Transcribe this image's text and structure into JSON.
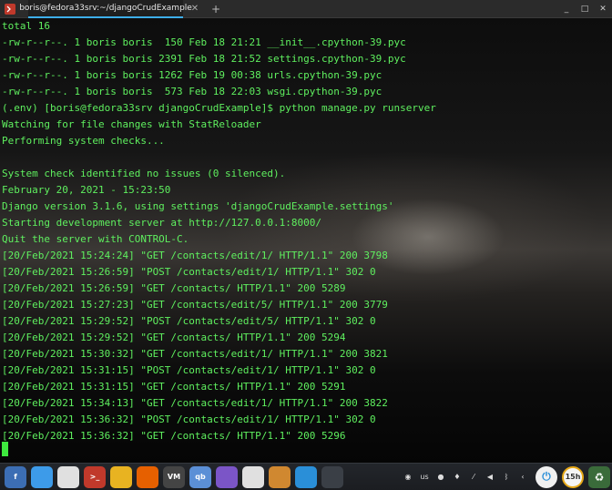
{
  "window": {
    "tab_title": "boris@fedora33srv:~/djangoCrudExample",
    "tab_close_glyph": "✕",
    "new_tab_glyph": "+",
    "minimize_glyph": "_",
    "maximize_glyph": "□",
    "close_glyph": "✕"
  },
  "terminal": {
    "lines": [
      "total 16",
      "-rw-r--r--. 1 boris boris  150 Feb 18 21:21 __init__.cpython-39.pyc",
      "-rw-r--r--. 1 boris boris 2391 Feb 18 21:52 settings.cpython-39.pyc",
      "-rw-r--r--. 1 boris boris 1262 Feb 19 00:38 urls.cpython-39.pyc",
      "-rw-r--r--. 1 boris boris  573 Feb 18 22:03 wsgi.cpython-39.pyc",
      "(.env) [boris@fedora33srv djangoCrudExample]$ python manage.py runserver",
      "Watching for file changes with StatReloader",
      "Performing system checks...",
      "",
      "System check identified no issues (0 silenced).",
      "February 20, 2021 - 15:23:50",
      "Django version 3.1.6, using settings 'djangoCrudExample.settings'",
      "Starting development server at http://127.0.0.1:8000/",
      "Quit the server with CONTROL-C.",
      "[20/Feb/2021 15:24:24] \"GET /contacts/edit/1/ HTTP/1.1\" 200 3798",
      "[20/Feb/2021 15:26:59] \"POST /contacts/edit/1/ HTTP/1.1\" 302 0",
      "[20/Feb/2021 15:26:59] \"GET /contacts/ HTTP/1.1\" 200 5289",
      "[20/Feb/2021 15:27:23] \"GET /contacts/edit/5/ HTTP/1.1\" 200 3779",
      "[20/Feb/2021 15:29:52] \"POST /contacts/edit/5/ HTTP/1.1\" 302 0",
      "[20/Feb/2021 15:29:52] \"GET /contacts/ HTTP/1.1\" 200 5294",
      "[20/Feb/2021 15:30:32] \"GET /contacts/edit/1/ HTTP/1.1\" 200 3821",
      "[20/Feb/2021 15:31:15] \"POST /contacts/edit/1/ HTTP/1.1\" 302 0",
      "[20/Feb/2021 15:31:15] \"GET /contacts/ HTTP/1.1\" 200 5291",
      "[20/Feb/2021 15:34:13] \"GET /contacts/edit/1/ HTTP/1.1\" 200 3822",
      "[20/Feb/2021 15:36:32] \"POST /contacts/edit/1/ HTTP/1.1\" 302 0",
      "[20/Feb/2021 15:36:32] \"GET /contacts/ HTTP/1.1\" 200 5296"
    ]
  },
  "taskbar": {
    "apps": [
      {
        "name": "fedora-icon",
        "label": "f",
        "color": "#3c6eb4"
      },
      {
        "name": "software-store-icon",
        "label": "",
        "color": "#3d9be9"
      },
      {
        "name": "settings-gear-icon",
        "label": "",
        "color": "#e0e0e0"
      },
      {
        "name": "terminal-icon",
        "label": ">_",
        "color": "#c0392b"
      },
      {
        "name": "chrome-icon",
        "label": "",
        "color": "#e8b321"
      },
      {
        "name": "firefox-icon",
        "label": "",
        "color": "#e66000"
      },
      {
        "name": "virt-manager-icon",
        "label": "VM",
        "color": "#444444"
      },
      {
        "name": "qbittorrent-icon",
        "label": "qb",
        "color": "#5b8fd6"
      },
      {
        "name": "media-player-icon",
        "label": "",
        "color": "#7b55c7"
      },
      {
        "name": "theme-tool-icon",
        "label": "",
        "color": "#e0e0e0"
      },
      {
        "name": "image-viewer-icon",
        "label": "",
        "color": "#d08830"
      },
      {
        "name": "window-switcher-icon",
        "label": "",
        "color": "#2a8fd8"
      },
      {
        "name": "monitor-icon",
        "label": "",
        "color": "#3a3f46"
      }
    ],
    "tray": [
      {
        "name": "network-icon",
        "label": "◉"
      },
      {
        "name": "keyboard-layout-indicator",
        "label": "us"
      },
      {
        "name": "tray-app-icon",
        "label": "●"
      },
      {
        "name": "microphone-icon",
        "label": "♦"
      },
      {
        "name": "mic-muted-icon",
        "label": "⁄"
      },
      {
        "name": "volume-icon",
        "label": "◀"
      },
      {
        "name": "bluetooth-icon",
        "label": "ᛒ"
      },
      {
        "name": "chevron-left-icon",
        "label": "‹"
      }
    ],
    "power_label": "⏻",
    "clock_label": "15h",
    "trash_label": "♻"
  }
}
